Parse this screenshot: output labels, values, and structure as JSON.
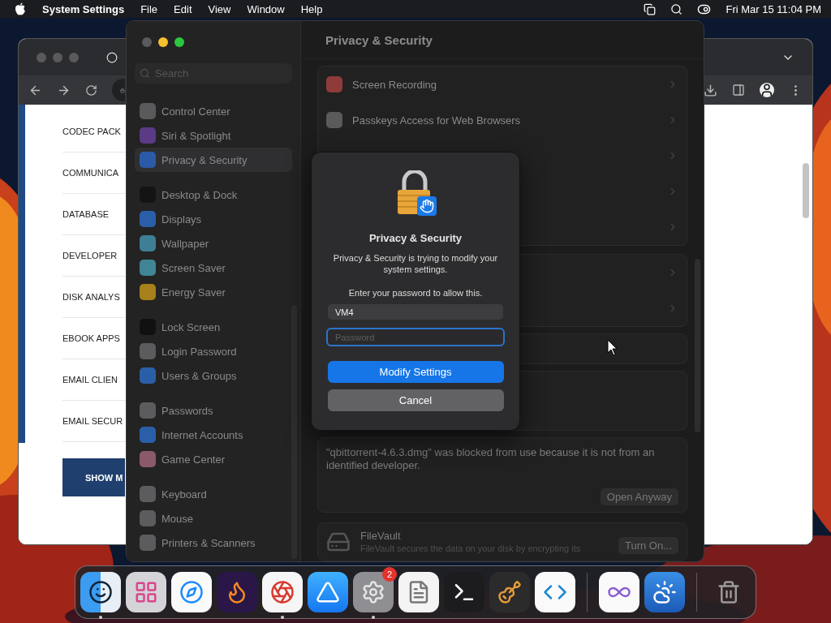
{
  "menu_bar": {
    "app_name": "System Settings",
    "menus": [
      "File",
      "Edit",
      "View",
      "Window",
      "Help"
    ],
    "clock": "Fri Mar 15  11:04 PM"
  },
  "browser": {
    "list_items": [
      "CODEC PACK",
      "COMMUNICA",
      "DATABASE",
      "DEVELOPER",
      "DISK ANALYS",
      "EBOOK APPS",
      "EMAIL CLIEN",
      "EMAIL SECUR"
    ],
    "show_button": "SHOW M"
  },
  "settings": {
    "search": {
      "placeholder": "Search"
    },
    "sidebar_groups": [
      [
        {
          "label": "Control Center",
          "color": "#5a5a5c",
          "selected": false
        },
        {
          "label": "Siri & Spotlight",
          "color": "#5b3a86",
          "selected": false
        },
        {
          "label": "Privacy & Security",
          "color": "#2a5aa8",
          "selected": true
        }
      ],
      [
        {
          "label": "Desktop & Dock",
          "color": "#141414",
          "selected": false
        },
        {
          "label": "Displays",
          "color": "#2a5fa8",
          "selected": false
        },
        {
          "label": "Wallpaper",
          "color": "#3f7f95",
          "selected": false
        },
        {
          "label": "Screen Saver",
          "color": "#3f8596",
          "selected": false
        },
        {
          "label": "Energy Saver",
          "color": "#a8801c",
          "selected": false
        }
      ],
      [
        {
          "label": "Lock Screen",
          "color": "#111111",
          "selected": false
        },
        {
          "label": "Login Password",
          "color": "#5c5c5e",
          "selected": false
        },
        {
          "label": "Users & Groups",
          "color": "#2a5fa8",
          "selected": false
        }
      ],
      [
        {
          "label": "Passwords",
          "color": "#5c5c5e",
          "selected": false
        },
        {
          "label": "Internet Accounts",
          "color": "#2a5fa8",
          "selected": false
        },
        {
          "label": "Game Center",
          "color": "#8a5a6a",
          "selected": false
        }
      ],
      [
        {
          "label": "Keyboard",
          "color": "#5c5c5e",
          "selected": false
        },
        {
          "label": "Mouse",
          "color": "#5c5c5e",
          "selected": false
        },
        {
          "label": "Printers & Scanners",
          "color": "#5c5c5e",
          "selected": false
        }
      ]
    ],
    "title": "Privacy & Security",
    "cards": [
      {
        "rows": [
          {
            "kind": "item",
            "label": "Screen Recording",
            "color": "#8f3b3a"
          },
          {
            "kind": "item",
            "label": "Passkeys Access for Web Browsers",
            "color": "#5a5a5c"
          },
          {
            "kind": "covered"
          },
          {
            "kind": "covered"
          },
          {
            "kind": "covered"
          }
        ]
      },
      {
        "rows": [
          {
            "kind": "covered"
          },
          {
            "kind": "covered"
          }
        ]
      },
      {
        "rows": [
          {
            "kind": "blank"
          }
        ]
      },
      {
        "rows": [
          {
            "kind": "blank"
          },
          {
            "kind": "blank"
          }
        ]
      }
    ],
    "notice": {
      "text": "\"qbittorrent-4.6.3.dmg\" was blocked from use because it is not from an identified developer.",
      "button": "Open Anyway"
    },
    "filevault": {
      "title": "FileVault",
      "description": "FileVault secures the data on your disk by encrypting its",
      "button": "Turn On..."
    }
  },
  "dialog": {
    "title": "Privacy & Security",
    "message": "Privacy & Security is trying to modify your system settings.",
    "prompt": "Enter your password to allow this.",
    "username": {
      "value": "VM4"
    },
    "password": {
      "placeholder": "Password",
      "focused": true
    },
    "buttons": [
      {
        "label": "Modify Settings",
        "kind": "primary"
      },
      {
        "label": "Cancel",
        "kind": "secondary"
      }
    ]
  },
  "dock": {
    "sections": [
      [
        {
          "running": true
        },
        {
          "running": false
        },
        {
          "running": false
        },
        {
          "running": false
        },
        {
          "running": true
        },
        {
          "running": false
        },
        {
          "running": true,
          "badge": "2"
        },
        {
          "running": false
        },
        {
          "running": false
        },
        {
          "running": false
        },
        {
          "running": false
        }
      ],
      [
        {
          "running": false
        },
        {
          "running": false
        }
      ],
      [
        {
          "running": false
        }
      ]
    ]
  }
}
